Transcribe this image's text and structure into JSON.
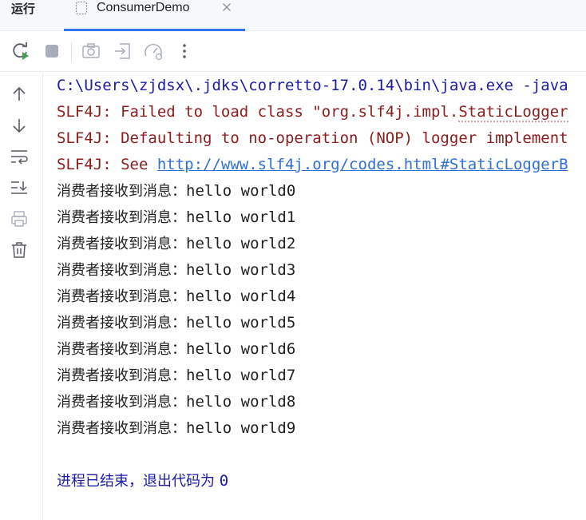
{
  "tabbar": {
    "run_label": "运行",
    "tab_label": "ConsumerDemo"
  },
  "console": {
    "cmd_line": "C:\\Users\\zjdsx\\.jdks\\corretto-17.0.14\\bin\\java.exe -java",
    "err1_prefix": "SLF4J: Failed to load class \"org.slf4j.impl.",
    "err1_dotted": "StaticLogger",
    "err2": "SLF4J: Defaulting to no-operation (NOP) logger implement",
    "err3_prefix": "SLF4J: See ",
    "err3_link": "http://www.slf4j.org/codes.html#StaticLoggerB",
    "messages": [
      {
        "label": "消费者接收到消息：",
        "text": "hello world0"
      },
      {
        "label": "消费者接收到消息：",
        "text": "hello world1"
      },
      {
        "label": "消费者接收到消息：",
        "text": "hello world2"
      },
      {
        "label": "消费者接收到消息：",
        "text": "hello world3"
      },
      {
        "label": "消费者接收到消息：",
        "text": "hello world4"
      },
      {
        "label": "消费者接收到消息：",
        "text": "hello world5"
      },
      {
        "label": "消费者接收到消息：",
        "text": "hello world6"
      },
      {
        "label": "消费者接收到消息：",
        "text": "hello world7"
      },
      {
        "label": "消费者接收到消息：",
        "text": "hello world8"
      },
      {
        "label": "消费者接收到消息：",
        "text": "hello world9"
      }
    ],
    "exit_label": "进程已结束，退出代码为 ",
    "exit_code": "0"
  },
  "icons": {
    "tab": "file-icon",
    "close": "close-icon",
    "rerun": "rerun-icon",
    "stop": "stop-icon",
    "screenshot": "camera-icon",
    "import": "import-icon",
    "profile": "gauge-icon",
    "more": "more-vertical-icon",
    "up": "arrow-up-icon",
    "down": "arrow-down-icon",
    "wrap": "soft-wrap-icon",
    "scroll": "scroll-to-end-icon",
    "print": "print-icon",
    "trash": "trash-icon"
  },
  "colors": {
    "accent": "#3574f0",
    "cmd": "#1a1aa6",
    "error": "#8c1c1c",
    "link": "#2f6fd6",
    "run_green": "#499c54"
  }
}
